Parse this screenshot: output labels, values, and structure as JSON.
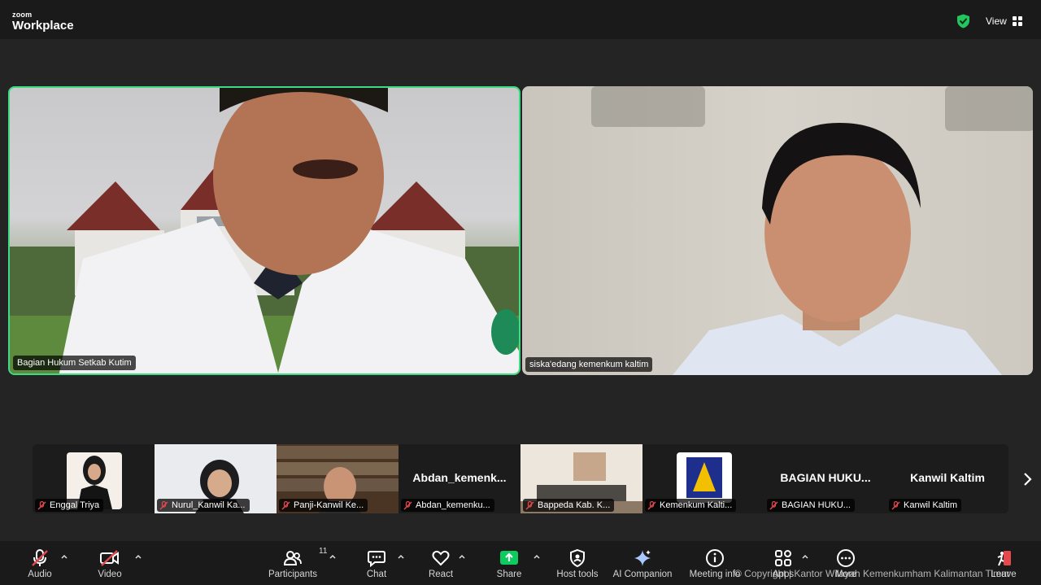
{
  "app": {
    "brand_small": "zoom",
    "brand_big": "Workplace",
    "view_label": "View"
  },
  "main_videos": [
    {
      "name": "Bagian Hukum Setkab Kutim",
      "active_speaker": true
    },
    {
      "name": "siska'edang kemenkum kaltim",
      "active_speaker": false
    }
  ],
  "gallery": [
    {
      "tag": "Enggal Triya",
      "big": ""
    },
    {
      "tag": "Nurul_Kanwil Ka...",
      "big": ""
    },
    {
      "tag": "Panji-Kanwil Ke...",
      "big": ""
    },
    {
      "tag": "Abdan_kemenku...",
      "big": "Abdan_kemenk..."
    },
    {
      "tag": "Bappeda Kab. K...",
      "big": ""
    },
    {
      "tag": "Kemenkum Kalti...",
      "big": ""
    },
    {
      "tag": "BAGIAN HUKU...",
      "big": "BAGIAN HUKU..."
    },
    {
      "tag": "Kanwil Kaltim",
      "big": "Kanwil Kaltim"
    }
  ],
  "toolbar": {
    "audio": "Audio",
    "video": "Video",
    "participants": "Participants",
    "participants_count": "11",
    "chat": "Chat",
    "react": "React",
    "share": "Share",
    "host_tools": "Host tools",
    "ai_companion": "AI Companion",
    "meeting_info": "Meeting info",
    "apps": "Apps",
    "more": "More",
    "leave": "Leave"
  },
  "watermark": "© Copyright | Kantor Wilayah Kemenkumham Kalimantan Timur",
  "colors": {
    "active_border": "#3ddc84",
    "share_green": "#0ecb5f",
    "mute_red": "#e5484d",
    "leave_red": "#e5484d"
  }
}
